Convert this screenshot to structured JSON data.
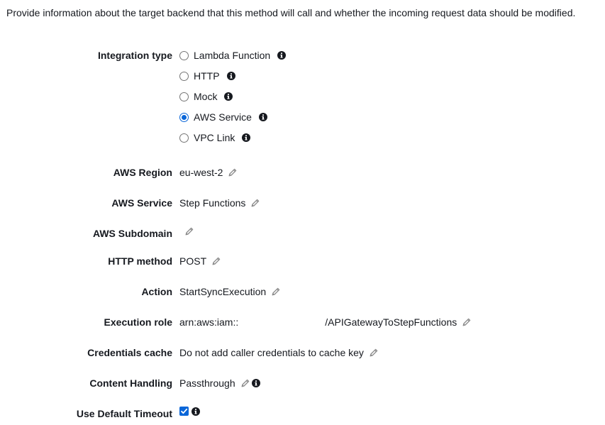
{
  "intro_text": "Provide information about the target backend that this method will call and whether the incoming request data should be modified.",
  "integration_type": {
    "label": "Integration type",
    "options": [
      {
        "label": "Lambda Function",
        "selected": false
      },
      {
        "label": "HTTP",
        "selected": false
      },
      {
        "label": "Mock",
        "selected": false
      },
      {
        "label": "AWS Service",
        "selected": true
      },
      {
        "label": "VPC Link",
        "selected": false
      }
    ]
  },
  "fields": {
    "aws_region": {
      "label": "AWS Region",
      "value": "eu-west-2"
    },
    "aws_service": {
      "label": "AWS Service",
      "value": "Step Functions"
    },
    "aws_subdomain": {
      "label": "AWS Subdomain",
      "value": ""
    },
    "http_method": {
      "label": "HTTP method",
      "value": "POST"
    },
    "action": {
      "label": "Action",
      "value": "StartSyncExecution"
    },
    "execution_role": {
      "label": "Execution role",
      "value_prefix": "arn:aws:iam::",
      "value_suffix": "/APIGatewayToStepFunctions"
    },
    "credentials_cache": {
      "label": "Credentials cache",
      "value": "Do not add caller credentials to cache key"
    },
    "content_handling": {
      "label": "Content Handling",
      "value": "Passthrough"
    },
    "use_default_timeout": {
      "label": "Use Default Timeout",
      "checked": true
    }
  },
  "icons": {
    "info": "info-icon",
    "edit": "pencil-icon"
  },
  "colors": {
    "accent": "#0a66d8",
    "text": "#16191f",
    "icon_gray": "#8a8a8a"
  }
}
